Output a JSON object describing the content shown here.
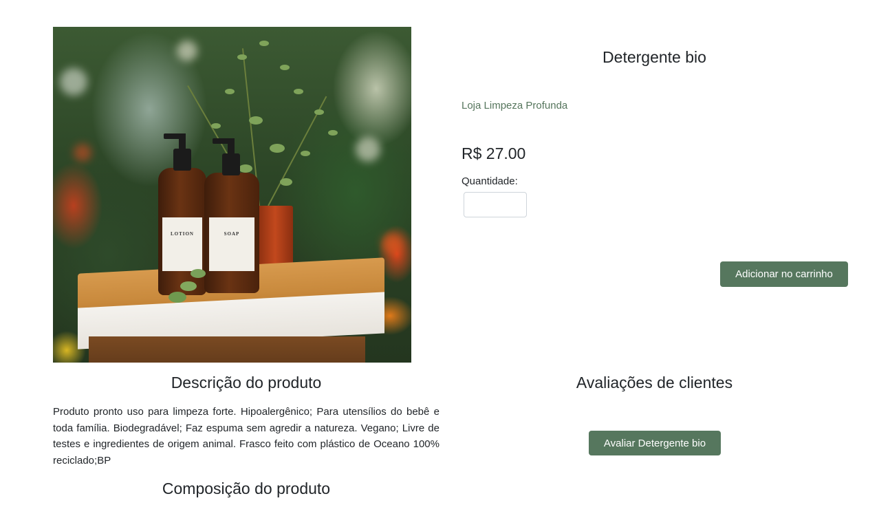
{
  "product": {
    "title": "Detergente bio",
    "store": "Loja Limpeza Profunda",
    "price": "R$ 27.00",
    "quantity_label": "Quantidade:",
    "quantity_value": "",
    "add_to_cart_label": "Adicionar no carrinho",
    "image_label_left": "LOTION",
    "image_label_right": "SOAP"
  },
  "description": {
    "title": "Descrição do produto",
    "text": "Produto pronto uso para limpeza forte. Hipoalergênico; Para utensílios do bebê e toda família. Biodegradável; Faz espuma sem agredir a natureza. Vegano; Livre de testes e ingredientes de origem animal. Frasco feito com plástico de Oceano 100% reciclado;BP"
  },
  "reviews": {
    "title": "Avaliações de clientes",
    "rate_button_label": "Avaliar Detergente bio"
  },
  "composition": {
    "title": "Composição do produto"
  },
  "colors": {
    "accent": "#56775e",
    "store_text": "#55755c",
    "text": "#212529"
  }
}
